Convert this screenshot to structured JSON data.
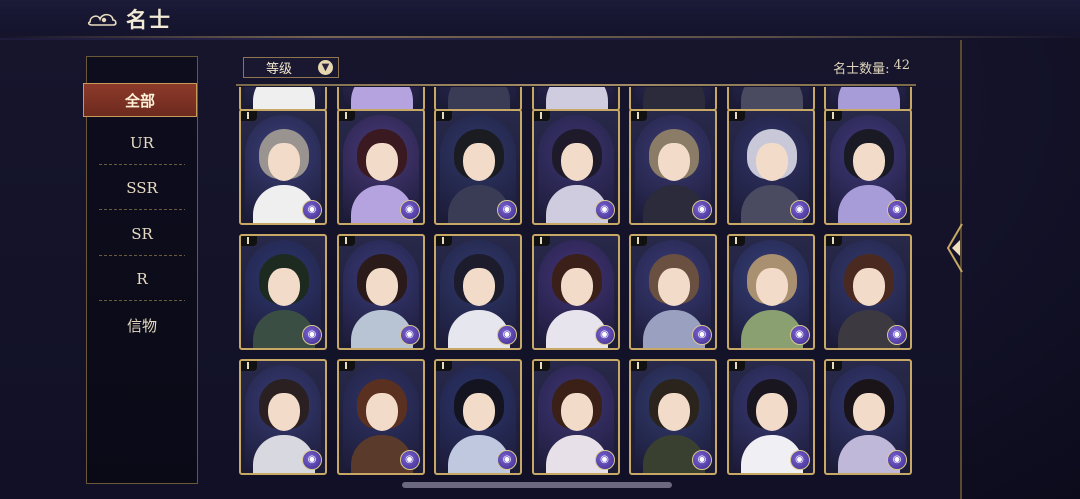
{
  "header": {
    "title": "名士",
    "emblem_icon": "cloud-emblem-icon"
  },
  "sidebar": {
    "items": [
      {
        "label": "全部",
        "active": true
      },
      {
        "label": "UR"
      },
      {
        "label": "SSR"
      },
      {
        "label": "SR"
      },
      {
        "label": "R"
      },
      {
        "label": "信物"
      }
    ]
  },
  "toolbar": {
    "sort_label": "等级",
    "sort_icon": "chevron-down-icon",
    "count_label": "名士数量:",
    "count_value": "42"
  },
  "grid": {
    "columns": 7,
    "visible_full_rows": 3,
    "cards": [
      {
        "hair": "#9a9490",
        "robe": "#efefef",
        "bg": "#3a3f78"
      },
      {
        "hair": "#3a1a20",
        "robe": "#b5a3e0",
        "bg": "#4a3a7a"
      },
      {
        "hair": "#1b1b22",
        "robe": "#3a3c56",
        "bg": "#2f3868"
      },
      {
        "hair": "#1e1a2a",
        "robe": "#d0cce0",
        "bg": "#3c3570"
      },
      {
        "hair": "#8a7c66",
        "robe": "#2b2b3c",
        "bg": "#3a3a72"
      },
      {
        "hair": "#c8c8d8",
        "robe": "#4a4a60",
        "bg": "#303466"
      },
      {
        "hair": "#1a1a24",
        "robe": "#a89cd8",
        "bg": "#413a7c"
      },
      {
        "hair": "#1d2a20",
        "robe": "#3b4e44",
        "bg": "#2e3870"
      },
      {
        "hair": "#2a1a1a",
        "robe": "#b8c4d4",
        "bg": "#393a78"
      },
      {
        "hair": "#1c1c2c",
        "robe": "#e6e6ee",
        "bg": "#303a6c"
      },
      {
        "hair": "#3a2018",
        "robe": "#e8e4ee",
        "bg": "#433478"
      },
      {
        "hair": "#6a5040",
        "robe": "#9aa0c0",
        "bg": "#3a3c78"
      },
      {
        "hair": "#a89070",
        "robe": "#8aa070",
        "bg": "#36407a"
      },
      {
        "hair": "#4a2a20",
        "robe": "#3c3a40",
        "bg": "#343a6e"
      },
      {
        "hair": "#2a2022",
        "robe": "#d8d8e0",
        "bg": "#373c74"
      },
      {
        "hair": "#5a3020",
        "robe": "#5a3a2a",
        "bg": "#2f3466"
      },
      {
        "hair": "#141420",
        "robe": "#c0c8e0",
        "bg": "#2c366c"
      },
      {
        "hair": "#3a2016",
        "robe": "#e8e0e8",
        "bg": "#403676"
      },
      {
        "hair": "#2a241c",
        "robe": "#3a4030",
        "bg": "#313c6e"
      },
      {
        "hair": "#1a1620",
        "robe": "#f0f0f4",
        "bg": "#383a74"
      },
      {
        "hair": "#1a1418",
        "robe": "#c0b8d8",
        "bg": "#343a72"
      }
    ]
  },
  "nav": {
    "side_arrow_icon": "arrow-left-icon",
    "badge_icon": "class-badge-icon"
  },
  "colors": {
    "accent_gold": "#c7a864",
    "active_red": "#8c3a2a",
    "badge_purple": "#5b46b4"
  }
}
